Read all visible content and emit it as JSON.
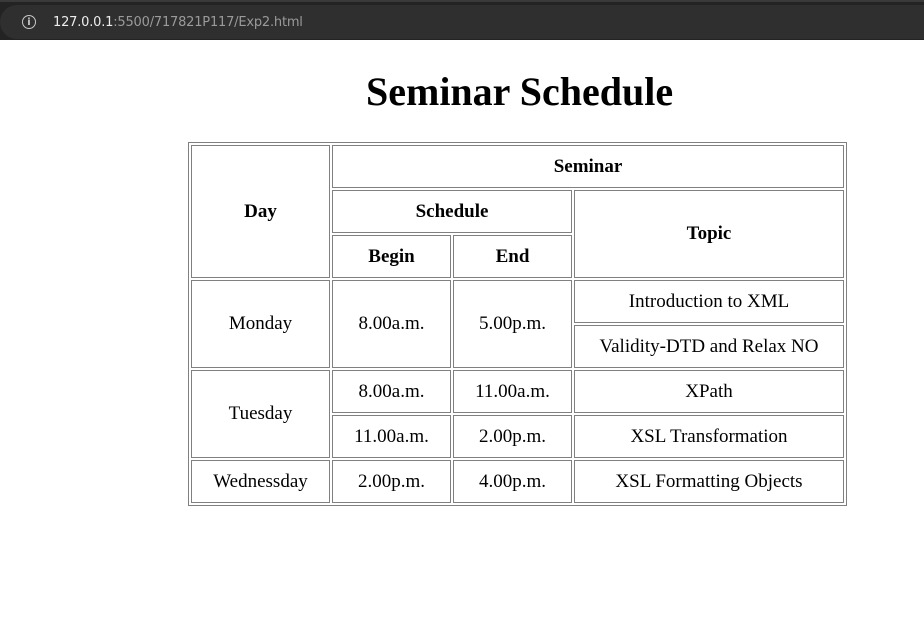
{
  "browser": {
    "url_host": "127.0.0.1",
    "url_rest": ":5500/717821P117/Exp2.html",
    "info_icon": "info-icon"
  },
  "page": {
    "title": "Seminar Schedule"
  },
  "table": {
    "headers": {
      "day": "Day",
      "seminar": "Seminar",
      "schedule": "Schedule",
      "topic": "Topic",
      "begin": "Begin",
      "end": "End"
    },
    "rows": {
      "monday": {
        "day": "Monday",
        "begin": "8.00a.m.",
        "end": "5.00p.m.",
        "topic1": "Introduction to XML",
        "topic2": "Validity-DTD and Relax NO"
      },
      "tuesday": {
        "day": "Tuesday",
        "s1_begin": "8.00a.m.",
        "s1_end": "11.00a.m.",
        "s1_topic": "XPath",
        "s2_begin": "11.00a.m.",
        "s2_end": "2.00p.m.",
        "s2_topic": "XSL Transformation"
      },
      "wednesday": {
        "day": "Wednessday",
        "begin": "2.00p.m.",
        "end": "4.00p.m.",
        "topic": "XSL Formatting Objects"
      }
    }
  }
}
